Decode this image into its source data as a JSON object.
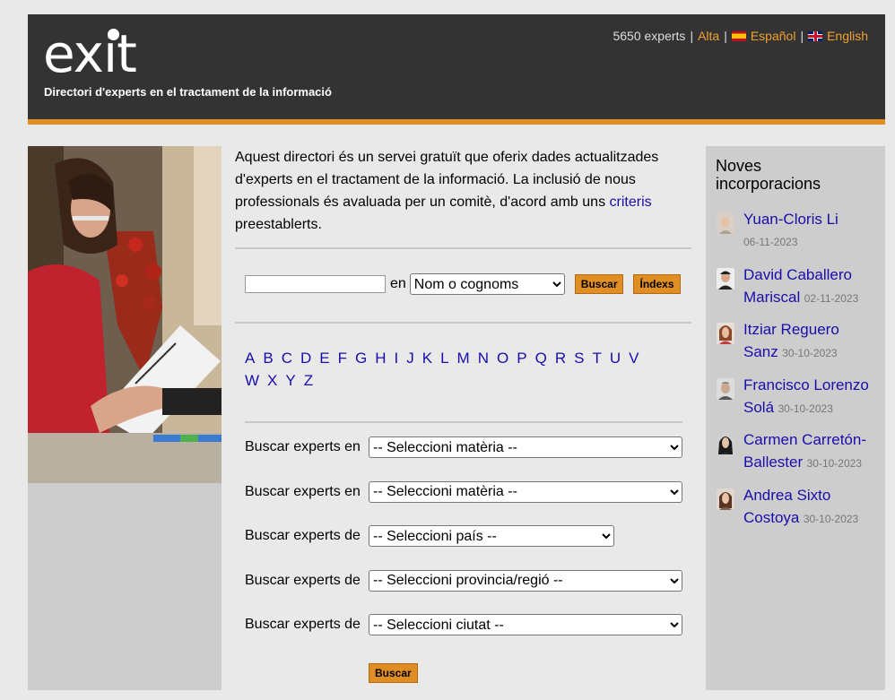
{
  "header": {
    "logo": "exit",
    "tagline": "Directori d'experts en el tractament de la informació",
    "count": "5650 experts",
    "sep": "|",
    "links": {
      "alta": "Alta",
      "espanol": "Español",
      "english": "English"
    }
  },
  "intro": {
    "text_before": "Aquest directori és un servei gratuït que oferix dades actualitzades d'experts en el tractament de la informació. La inclusió de nous professionals és avaluada per un comitè, d'acord amb uns ",
    "link": "criteris",
    "text_after": " preestablerts."
  },
  "search": {
    "input_value": "",
    "en_label": "en",
    "field_select": "Nom o cognoms",
    "buscar": "Buscar",
    "index": "Índexs"
  },
  "letters": [
    "A",
    "B",
    "C",
    "D",
    "E",
    "F",
    "G",
    "H",
    "I",
    "J",
    "K",
    "L",
    "M",
    "N",
    "O",
    "P",
    "Q",
    "R",
    "S",
    "T",
    "U",
    "V",
    "W",
    "X",
    "Y",
    "Z"
  ],
  "filters": [
    {
      "label": "Buscar experts en",
      "selected": "-- Seleccioni matèria --"
    },
    {
      "label": "Buscar experts en",
      "selected": "-- Seleccioni matèria --"
    },
    {
      "label": "Buscar experts de",
      "selected": "-- Seleccioni país --"
    },
    {
      "label": "Buscar experts de",
      "selected": "-- Seleccioni provincia/regió --"
    },
    {
      "label": "Buscar experts de",
      "selected": "-- Seleccioni ciutat --"
    }
  ],
  "filters_button": "Buscar",
  "sidebar": {
    "title": "Noves incorporacions",
    "people": [
      {
        "name": "Yuan-Cloris Li",
        "date": "06-11-2023"
      },
      {
        "name": "David Caballero Mariscal",
        "date": "02-11-2023"
      },
      {
        "name": "Itziar Reguero Sanz",
        "date": "30-10-2023"
      },
      {
        "name": "Francisco Lorenzo Solá",
        "date": "30-10-2023"
      },
      {
        "name": "Carmen Carretón-Ballester",
        "date": "30-10-2023"
      },
      {
        "name": "Andrea Sixto Costoya",
        "date": "30-10-2023"
      }
    ]
  },
  "colors": {
    "accent": "#e08d24",
    "header_bg": "#333333",
    "link": "#1a0dab"
  }
}
